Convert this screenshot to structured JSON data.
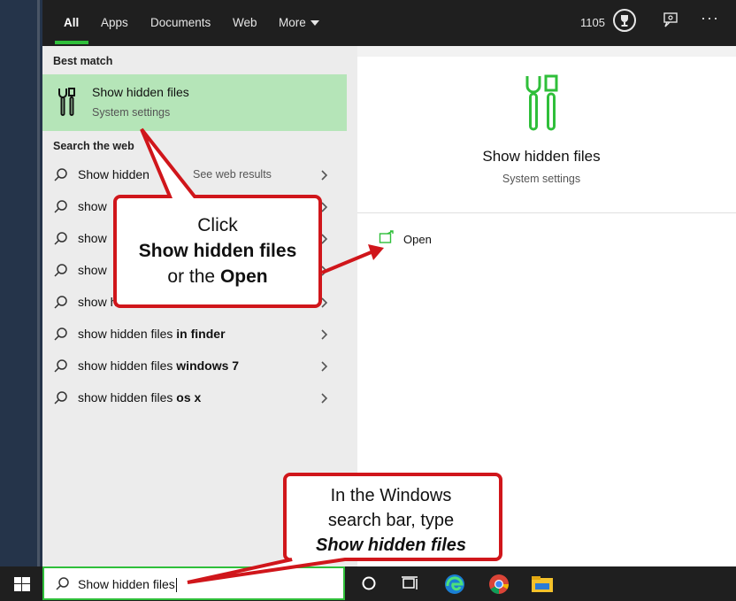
{
  "topbar": {
    "tabs": [
      {
        "label": "All"
      },
      {
        "label": "Apps"
      },
      {
        "label": "Documents"
      },
      {
        "label": "Web"
      },
      {
        "label": "More"
      }
    ],
    "points": "1105"
  },
  "results": {
    "best_match_label": "Best match",
    "best": {
      "title": "Show hidden files",
      "subtitle": "System settings"
    },
    "web_label": "Search the web",
    "web_hint": "See web results",
    "web_rows": [
      {
        "normal": "Show hidden",
        "bold": ""
      },
      {
        "normal": "show",
        "bold": ""
      },
      {
        "normal": "show",
        "bold": ""
      },
      {
        "normal": "show",
        "bold": ""
      },
      {
        "normal": "show h",
        "bold": ""
      },
      {
        "normal": "show hidden files ",
        "bold": "in finder"
      },
      {
        "normal": "show hidden files ",
        "bold": "windows 7"
      },
      {
        "normal": "show hidden files ",
        "bold": "os x"
      }
    ]
  },
  "preview": {
    "title": "Show hidden files",
    "subtitle": "System settings",
    "open_label": "Open"
  },
  "taskbar": {
    "search_value": "Show hidden files"
  },
  "callouts": {
    "top": {
      "line1": "Click",
      "line2": "Show hidden files",
      "line3_normal": "or the ",
      "line3_bold": "Open"
    },
    "bottom": {
      "line1": "In the Windows",
      "line2": "search bar, type",
      "line3": "Show hidden files"
    }
  },
  "colors": {
    "accent_green": "#2fbf3a",
    "callout_red": "#d0161b",
    "best_match_bg": "#b5e5b8"
  },
  "icons": [
    "settings-tools-icon",
    "search-icon",
    "chevron-right-icon",
    "open-icon",
    "windows-logo-icon",
    "cortana-icon",
    "task-view-icon",
    "edge-icon",
    "chrome-icon",
    "file-explorer-icon",
    "trophy-icon",
    "feedback-icon",
    "more-icon"
  ]
}
